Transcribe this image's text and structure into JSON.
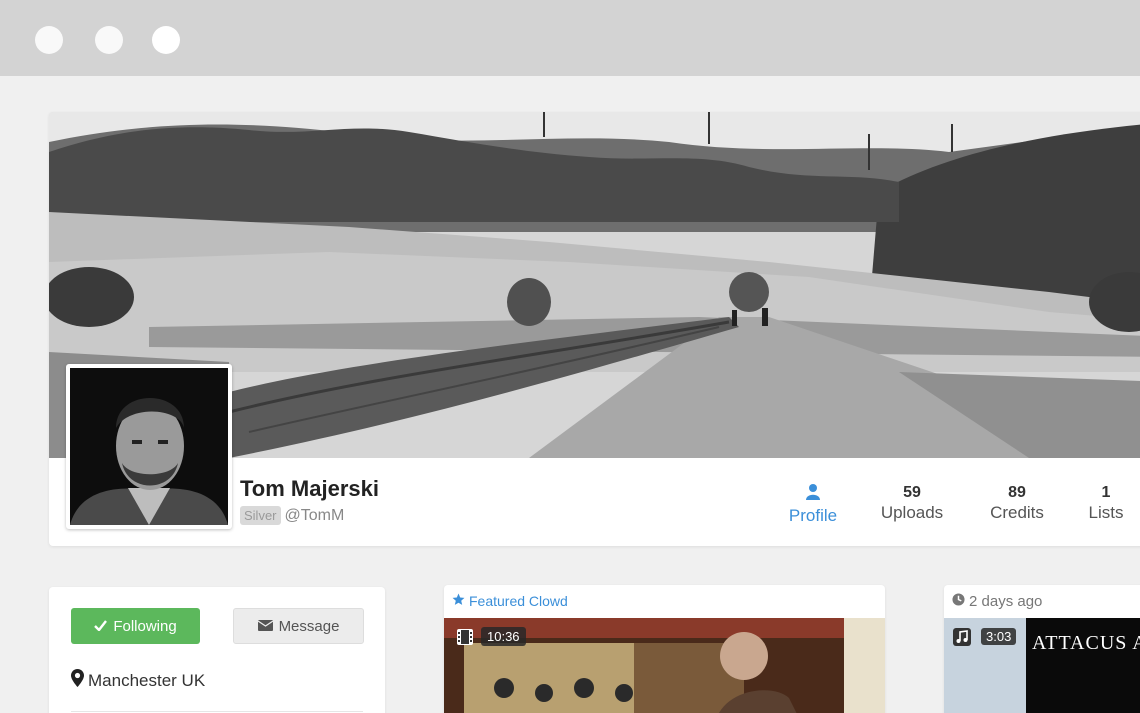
{
  "window": {
    "controls": [
      "close-dot",
      "minimize-dot",
      "zoom-dot"
    ]
  },
  "profile": {
    "name": "Tom Majerski",
    "tier_badge": "Silver",
    "handle": "@TomM",
    "stats": [
      {
        "key": "profile",
        "icon": "user-icon",
        "label": "Profile",
        "active": true
      },
      {
        "key": "uploads",
        "value": "59",
        "label": "Uploads"
      },
      {
        "key": "credits",
        "value": "89",
        "label": "Credits"
      },
      {
        "key": "lists",
        "value": "1",
        "label": "Lists"
      }
    ]
  },
  "sidebar": {
    "follow_label": "Following",
    "follow_icon": "check-icon",
    "message_label": "Message",
    "message_icon": "envelope-icon",
    "location": "Manchester UK",
    "location_icon": "map-marker-icon"
  },
  "featured": {
    "header": "Featured Clowd",
    "header_icon": "star-icon",
    "media_icon": "film-icon",
    "duration": "10:36"
  },
  "recent": {
    "header": "2 days ago",
    "header_icon": "clock-icon",
    "media_icon": "music-icon",
    "duration": "3:03",
    "title_text": "ATTACUS A"
  },
  "colors": {
    "accent": "#3b8fd9",
    "success": "#5cb85c",
    "titlebar": "#d3d3d3",
    "background": "#f0f0f0"
  }
}
